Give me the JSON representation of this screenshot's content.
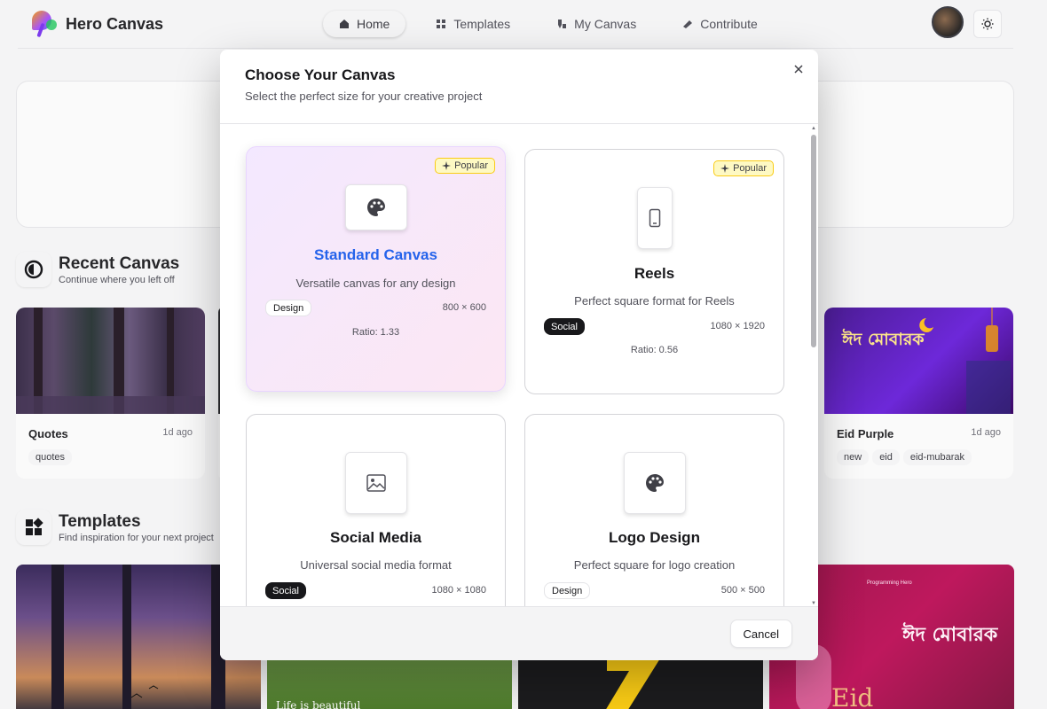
{
  "app": {
    "name": "Hero Canvas"
  },
  "nav": {
    "items": [
      {
        "label": "Home",
        "icon": "home-icon",
        "active": true
      },
      {
        "label": "Templates",
        "icon": "grid-icon",
        "active": false
      },
      {
        "label": "My Canvas",
        "icon": "brush-icon",
        "active": false
      },
      {
        "label": "Contribute",
        "icon": "paint-icon",
        "active": false
      }
    ]
  },
  "recent": {
    "title": "Recent Canvas",
    "subtitle": "Continue where you left off",
    "cards": [
      {
        "title": "Quotes",
        "ago": "1d ago",
        "tags": [
          "quotes"
        ]
      },
      {
        "title": "Eid Purple",
        "ago": "1d ago",
        "tags": [
          "new",
          "eid",
          "eid-mubarak"
        ],
        "image_text": "ঈদ মোবারক"
      }
    ]
  },
  "templates": {
    "title": "Templates",
    "subtitle": "Find inspiration for your next project",
    "items": [
      {
        "text": ""
      },
      {
        "text": "Life is beautiful"
      },
      {
        "text": ""
      },
      {
        "text": "ঈদ মোবারক",
        "brand": "Programming Hero"
      }
    ]
  },
  "modal": {
    "title": "Choose Your Canvas",
    "subtitle": "Select the perfect size for your creative project",
    "cancel_label": "Cancel",
    "options": [
      {
        "name": "Standard Canvas",
        "description": "Versatile canvas for any design",
        "category": "Design",
        "dimensions": "800 × 600",
        "ratio": "Ratio: 1.33",
        "badge": "Popular",
        "icon": "palette-icon",
        "selected": true
      },
      {
        "name": "Reels",
        "description": "Perfect square format for Reels",
        "category": "Social",
        "dimensions": "1080 × 1920",
        "ratio": "Ratio: 0.56",
        "badge": "Popular",
        "icon": "phone-icon",
        "selected": false
      },
      {
        "name": "Social Media",
        "description": "Universal social media format",
        "category": "Social",
        "dimensions": "1080 × 1080",
        "icon": "image-icon",
        "selected": false
      },
      {
        "name": "Logo Design",
        "description": "Perfect square for logo creation",
        "category": "Design",
        "dimensions": "500 × 500",
        "icon": "palette-icon",
        "selected": false
      }
    ]
  },
  "colors": {
    "accent": "#2563eb",
    "badge_bg": "#fef9c3",
    "selected_bg_from": "#f3e8ff",
    "selected_bg_to": "#fce7f3"
  }
}
